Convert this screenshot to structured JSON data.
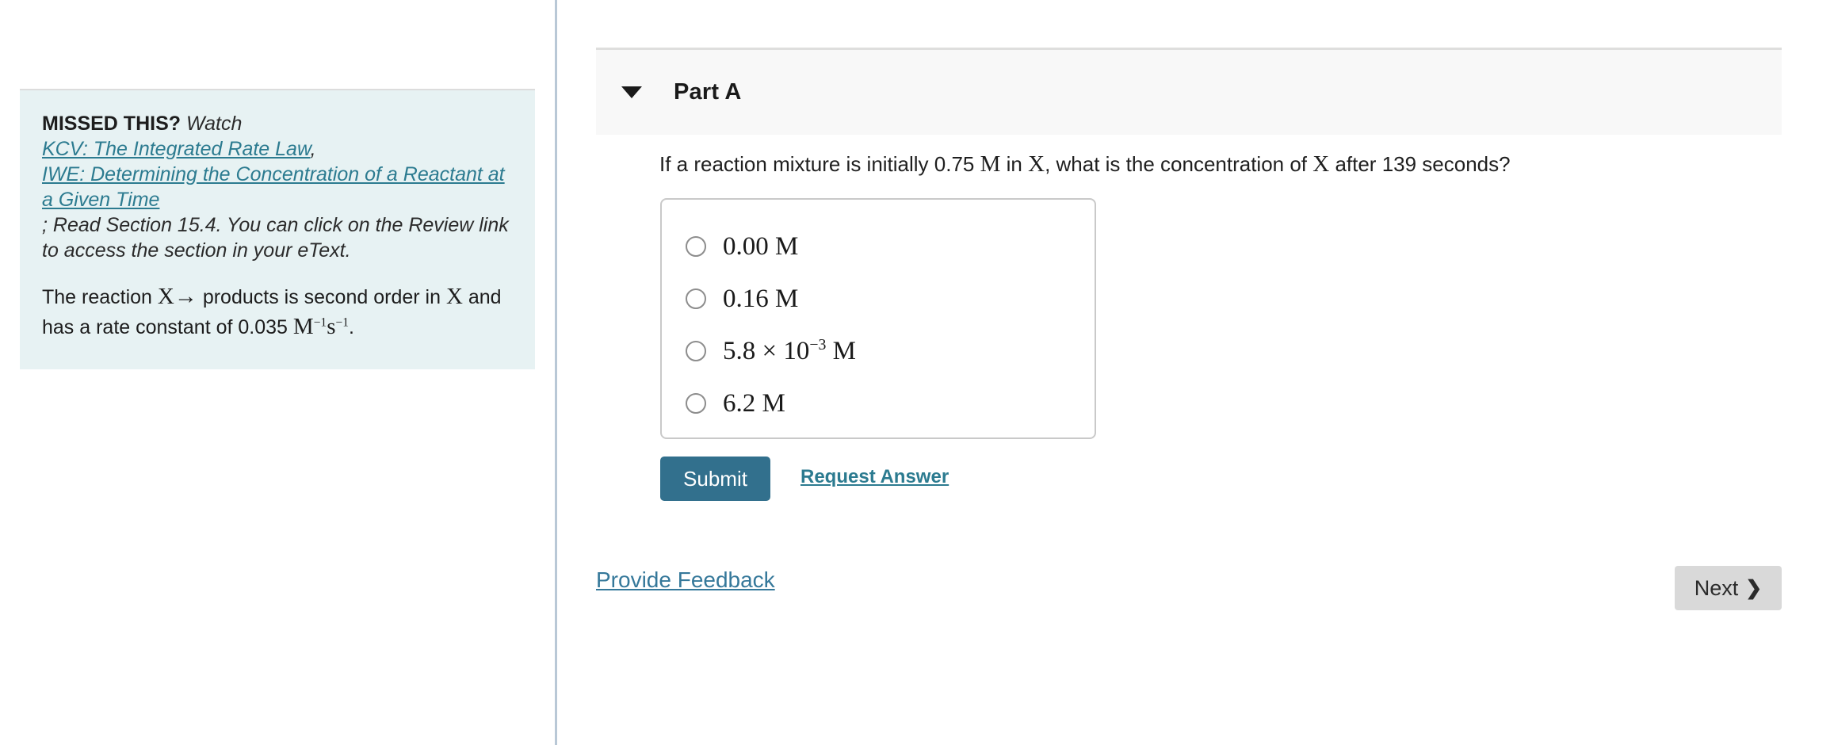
{
  "layout": {
    "divider_color": "#b9c8d6",
    "accent_link_color": "#2c7b90",
    "submit_button_color": "#32708d",
    "hint_background_color": "#e7f2f3",
    "header_background_color": "#f8f8f8"
  },
  "hint": {
    "missed_label": "MISSED THIS?",
    "watch_word": " Watch ",
    "link_1": "KCV: The Integrated Rate Law",
    "comma": ",",
    "link_2": "IWE: Determining the Concentration of a Reactant at a Given Time",
    "tail_text": "; Read Section 15.4. You can click on the Review link to access the section in your eText.",
    "reaction": {
      "text_1": "The reaction ",
      "species_1": "X",
      "arrow": "→",
      "text_2": " products is second order in ",
      "species_2": "X",
      "text_3": " and has a rate constant of 0.035 ",
      "unit_base_1": "M",
      "unit_exp_1": "−1",
      "unit_base_2": "s",
      "unit_exp_2": "−1",
      "period": "."
    }
  },
  "part": {
    "caret_icon": "triangle-down-icon",
    "title": "Part A",
    "question": {
      "text_1": "If a reaction mixture is initially 0.75 ",
      "unit_1": "M",
      "text_2": " in ",
      "species_1": "X",
      "text_3": ", what is the concentration of ",
      "species_2": "X",
      "text_4": " after 139 seconds?"
    },
    "choices": [
      {
        "id": "choice-a",
        "value": "0.00",
        "unit": "M",
        "exponent": null,
        "mantissa": null,
        "selected": false,
        "display": "0.00 M"
      },
      {
        "id": "choice-b",
        "value": "0.16",
        "unit": "M",
        "exponent": null,
        "mantissa": null,
        "selected": false,
        "display": "0.16 M"
      },
      {
        "id": "choice-c",
        "value": "5.8 × 10−3",
        "unit": "M",
        "exponent": "−3",
        "mantissa": "5.8 × 10",
        "selected": false,
        "display": "5.8 × 10−3 M"
      },
      {
        "id": "choice-d",
        "value": "6.2",
        "unit": "M",
        "exponent": null,
        "mantissa": null,
        "selected": false,
        "display": "6.2 M"
      }
    ],
    "submit_label": "Submit",
    "request_answer_label": "Request Answer"
  },
  "footer": {
    "provide_feedback_label": "Provide Feedback",
    "next_label": "Next",
    "next_chevron_icon": "❯"
  }
}
